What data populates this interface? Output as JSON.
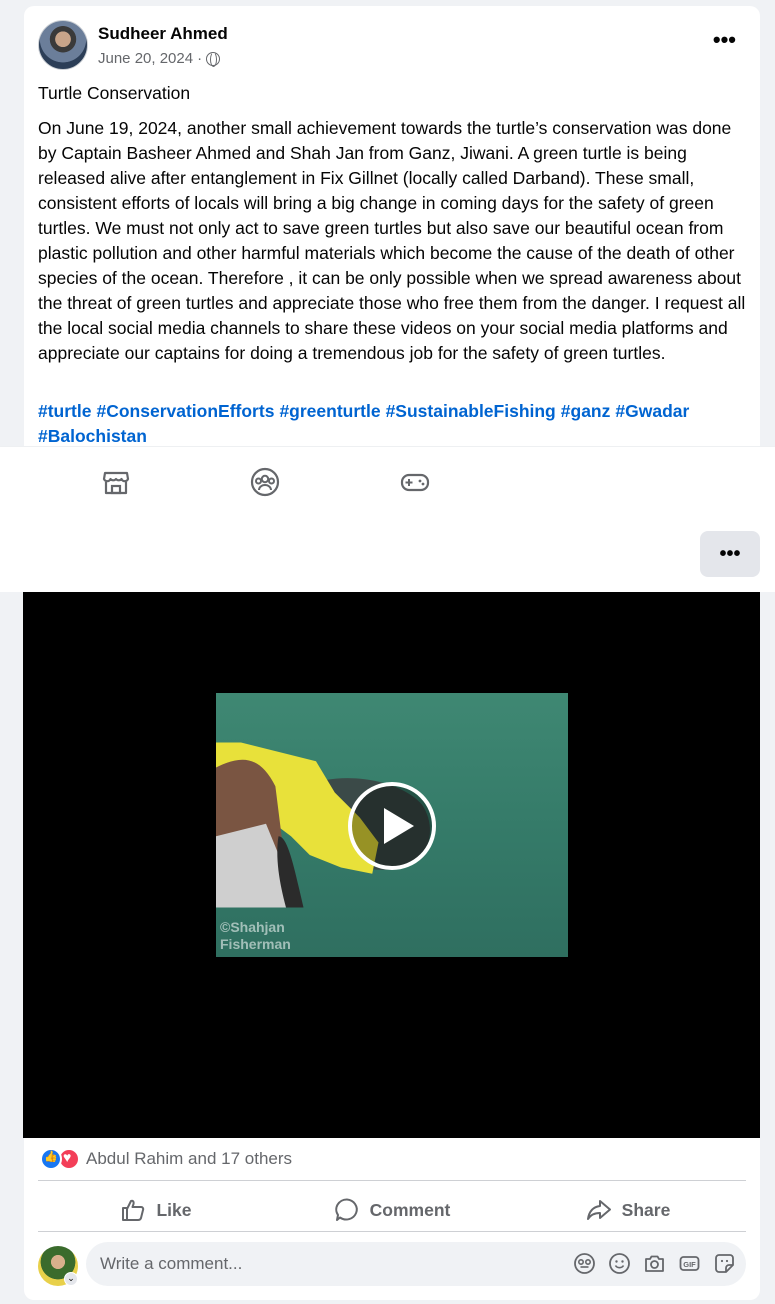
{
  "post": {
    "author": "Sudheer Ahmed",
    "date": "June 20, 2024",
    "date_sep": "·",
    "more": "•••",
    "title": "Turtle Conservation",
    "body": "On June 19, 2024, another small achievement towards the turtle’s conservation was done by Captain Basheer Ahmed and Shah Jan from Ganz, Jiwani. A green turtle is being released alive after entanglement in Fix Gillnet (locally called Darband). These small, consistent efforts of locals will bring a big change in coming days for the safety of green turtles. We must not only act to save green turtles but also save our beautiful ocean from plastic pollution and other harmful materials which become the cause of the death of other species of the ocean. Therefore , it can be only possible when we spread awareness about the threat of green turtles and appreciate those who free them from the danger. I request all the local social media channels to share these videos on your social media platforms and appreciate our captains for doing a tremendous job for the safety of green turtles.",
    "hashtags": [
      "#turtle",
      "#ConservationEfforts",
      "#greenturtle",
      "#SustainableFishing",
      "#ganz",
      "#Gwadar",
      "#Balochistan"
    ]
  },
  "nav": {
    "icons": [
      "marketplace-icon",
      "groups-icon",
      "gaming-icon"
    ]
  },
  "overlay_more": "•••",
  "video": {
    "watermark_line1": "©Shahjan",
    "watermark_line2": "Fisherman"
  },
  "reactions": {
    "text": "Abdul Rahim and 17 others"
  },
  "actions": {
    "like": "Like",
    "comment": "Comment",
    "share": "Share"
  },
  "comment_box": {
    "placeholder": "Write a comment...",
    "tools": [
      "avatar-sticker-icon",
      "emoji-icon",
      "camera-icon",
      "gif-icon",
      "sticker-icon"
    ]
  },
  "colors": {
    "link": "#0064d1",
    "like_blue": "#1877f2",
    "love_red": "#f33e58"
  }
}
